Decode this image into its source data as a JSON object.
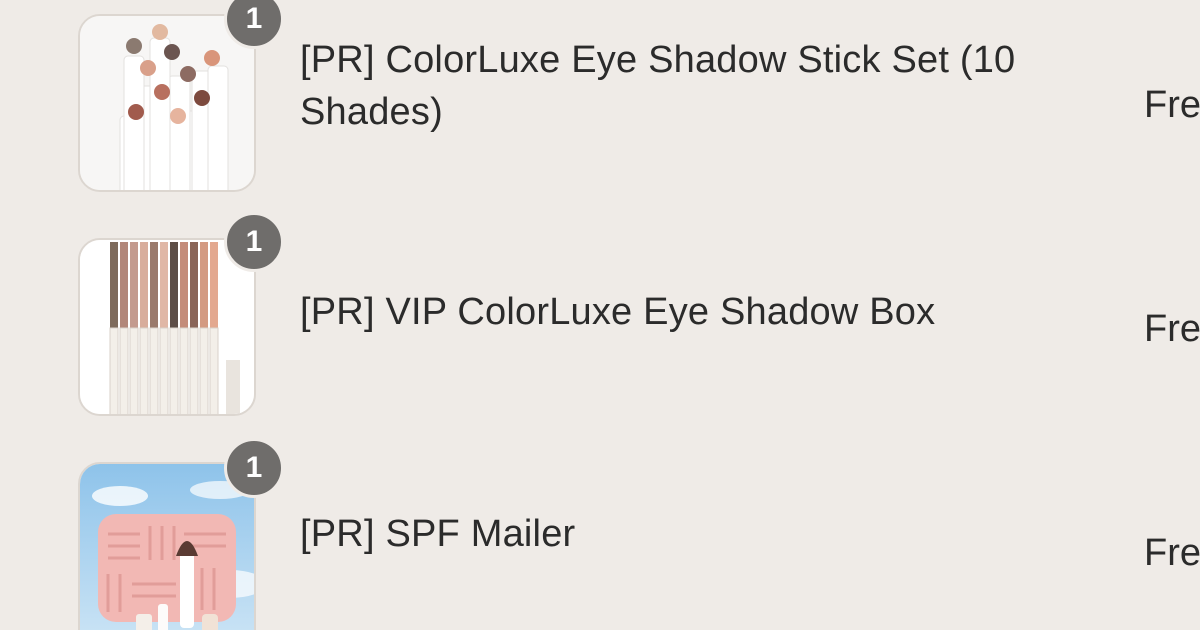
{
  "order_items": [
    {
      "quantity": "1",
      "title": "[PR] ColorLuxe Eye Shadow Stick Set (10 Shades)",
      "price": "Fre",
      "image_icon": "eyeshadow-stick-set-image"
    },
    {
      "quantity": "1",
      "title": "[PR] VIP ColorLuxe Eye Shadow Box",
      "price": "Fre",
      "image_icon": "eyeshadow-pencils-box-image"
    },
    {
      "quantity": "1",
      "title": "[PR] SPF Mailer",
      "price": "Fre",
      "image_icon": "spf-mailer-pouch-image"
    }
  ],
  "colors": {
    "background": "#efebe7",
    "badge": "#6f6d6b",
    "text": "#2b2b2b"
  }
}
